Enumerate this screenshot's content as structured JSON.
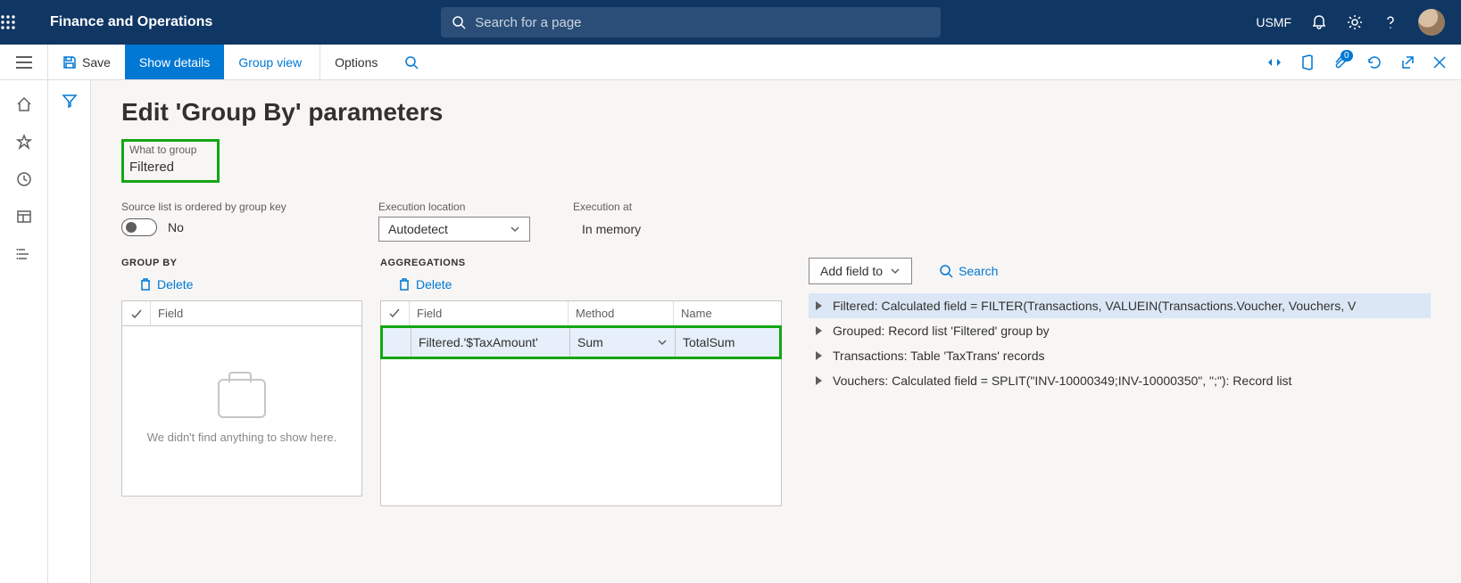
{
  "topbar": {
    "app_title": "Finance and Operations",
    "search_placeholder": "Search for a page",
    "company": "USMF"
  },
  "actionbar": {
    "save": "Save",
    "show_details": "Show details",
    "group_view": "Group view",
    "options": "Options",
    "badge_count": "0"
  },
  "page": {
    "title": "Edit 'Group By' parameters",
    "what_to_group_label": "What to group",
    "what_to_group_value": "Filtered",
    "ordered_label": "Source list is ordered by group key",
    "ordered_value": "No",
    "exec_loc_label": "Execution location",
    "exec_loc_value": "Autodetect",
    "exec_at_label": "Execution at",
    "exec_at_value": "In memory"
  },
  "groupby": {
    "heading": "GROUP BY",
    "delete": "Delete",
    "col_field": "Field",
    "empty_msg": "We didn't find anything to show here."
  },
  "agg": {
    "heading": "AGGREGATIONS",
    "delete": "Delete",
    "col_field": "Field",
    "col_method": "Method",
    "col_name": "Name",
    "row": {
      "field": "Filtered.'$TaxAmount'",
      "method": "Sum",
      "name": "TotalSum"
    }
  },
  "tree": {
    "add_field": "Add field to",
    "search": "Search",
    "rows": [
      "Filtered: Calculated field = FILTER(Transactions, VALUEIN(Transactions.Voucher, Vouchers, V",
      "Grouped: Record list 'Filtered' group by",
      "Transactions: Table 'TaxTrans' records",
      "Vouchers: Calculated field = SPLIT(\"INV-10000349;INV-10000350\", \";\"): Record list"
    ]
  }
}
